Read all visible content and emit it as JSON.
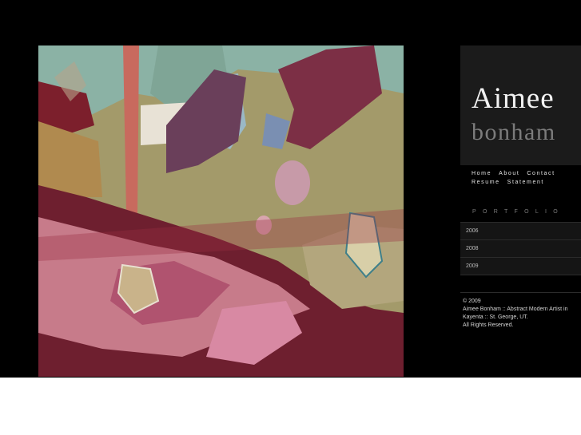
{
  "artist": {
    "first_name": "Aimee",
    "last_name": "bonham"
  },
  "nav": {
    "items": [
      "Home",
      "About",
      "Contact",
      "Resume",
      "Statement"
    ]
  },
  "portfolio": {
    "label": "PORTFOLIO",
    "years": [
      "2006",
      "2008",
      "2009"
    ]
  },
  "footer": {
    "copyright": "© 2009",
    "description": "Aimee Bonham :: Abstract Modern Artist in Kayenta :: St. George, UT.",
    "rights": "All Rights Reserved."
  },
  "colors": {
    "background": "#000000",
    "name_panel": "#1b1b1b",
    "menu_row": "#151515"
  }
}
